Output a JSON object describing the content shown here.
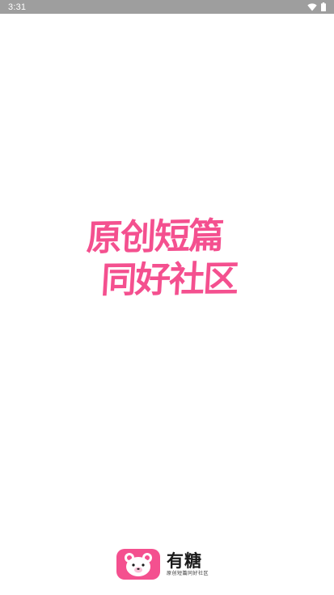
{
  "status_bar": {
    "time": "3:31",
    "icons": [
      "wifi-icon",
      "battery-icon"
    ]
  },
  "splash": {
    "slogan_line_1": "原创短篇",
    "slogan_line_2": "同好社区"
  },
  "brand": {
    "name": "有糖",
    "tagline": "原创短篇同好社区",
    "logo_icon": "bear-logo-icon"
  },
  "colors": {
    "accent": "#f4508f",
    "status_bar": "#9e9e9e",
    "background": "#ffffff"
  }
}
